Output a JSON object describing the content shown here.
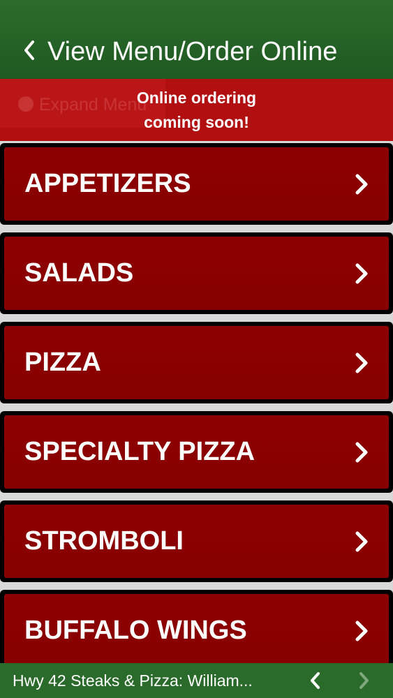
{
  "header": {
    "title": "View Menu/Order Online",
    "back_icon": "chevron-left-icon"
  },
  "banner": {
    "ghost_text": "Expand Menu",
    "notice_line1": "Online ordering",
    "notice_line2": "coming soon!"
  },
  "menu": {
    "items": [
      {
        "label": "APPETIZERS"
      },
      {
        "label": "SALADS"
      },
      {
        "label": "PIZZA"
      },
      {
        "label": "SPECIALTY PIZZA"
      },
      {
        "label": "STROMBOLI"
      },
      {
        "label": "BUFFALO WINGS"
      }
    ]
  },
  "footer": {
    "title": "Hwy 42 Steaks & Pizza: William...",
    "prev_icon": "arrow-left-icon",
    "next_icon": "arrow-right-icon"
  },
  "colors": {
    "header_green": "#1f5a22",
    "banner_red": "#b10f10",
    "item_red": "#8b0000",
    "footer_green": "#2a6a2a"
  }
}
